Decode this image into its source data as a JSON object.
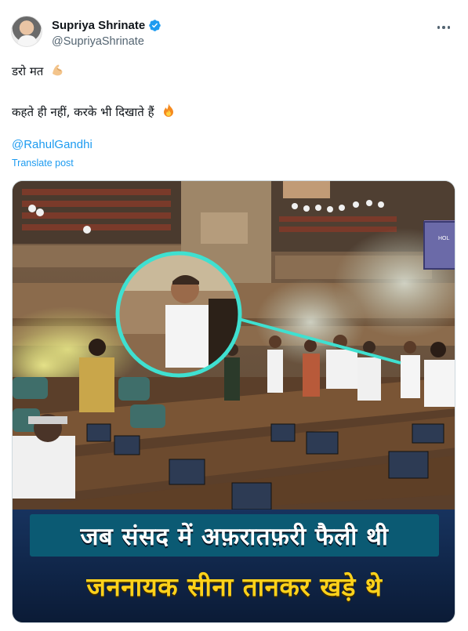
{
  "author": {
    "display_name": "Supriya Shrinate",
    "handle": "@SupriyaShrinate",
    "verified": true
  },
  "tweet": {
    "line1": "डरो मत",
    "line1_emoji": "flexed-biceps-icon",
    "line2": "कहते ही नहीं, करके भी दिखाते हैं",
    "line2_emoji": "fire-icon",
    "mention": "@RahulGandhi",
    "translate_label": "Translate post"
  },
  "media": {
    "caption_line1": "जब संसद में अफ़रातफ़री फैली थी",
    "caption_line2": "जननायक सीना तानकर खड़े थे",
    "screen_text": "HOL"
  },
  "colors": {
    "link": "#1d9bf0",
    "verified_badge": "#1d9bf0",
    "caption_primary": "#ffffff",
    "caption_accent": "#ffd21a",
    "highlight_ring": "#3fe0d0"
  }
}
